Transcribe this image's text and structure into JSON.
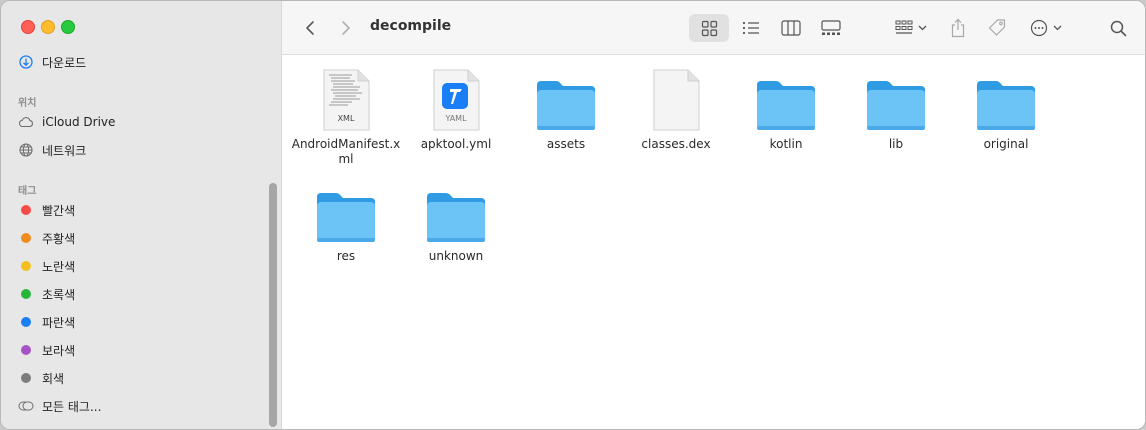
{
  "window": {
    "title": "decompile"
  },
  "sidebar": {
    "downloads_label": "다운로드",
    "location_section": "위치",
    "locations": [
      {
        "label": "iCloud Drive",
        "icon": "cloud-icon"
      },
      {
        "label": "네트워크",
        "icon": "globe-icon"
      }
    ],
    "tags_section": "태그",
    "tags": [
      {
        "label": "빨간색",
        "color": "#f74b48"
      },
      {
        "label": "주황색",
        "color": "#f08c1e"
      },
      {
        "label": "노란색",
        "color": "#f2c01c"
      },
      {
        "label": "초록색",
        "color": "#28b53b"
      },
      {
        "label": "파란색",
        "color": "#1a7ef5"
      },
      {
        "label": "보라색",
        "color": "#a653c6"
      },
      {
        "label": "회색",
        "color": "#7c7c7f"
      }
    ],
    "all_tags_label": "모든 태그..."
  },
  "files": [
    {
      "name": "AndroidManifest.xml",
      "kind": "xml",
      "badge": "XML"
    },
    {
      "name": "apktool.yml",
      "kind": "yaml",
      "badge": "YAML"
    },
    {
      "name": "assets",
      "kind": "folder"
    },
    {
      "name": "classes.dex",
      "kind": "doc"
    },
    {
      "name": "kotlin",
      "kind": "folder"
    },
    {
      "name": "lib",
      "kind": "folder"
    },
    {
      "name": "original",
      "kind": "folder"
    },
    {
      "name": "res",
      "kind": "folder"
    },
    {
      "name": "unknown",
      "kind": "folder"
    }
  ],
  "colors": {
    "folder_front": "#6cc3f5",
    "folder_back": "#2f9be2",
    "accent": "#1a7ef5"
  }
}
